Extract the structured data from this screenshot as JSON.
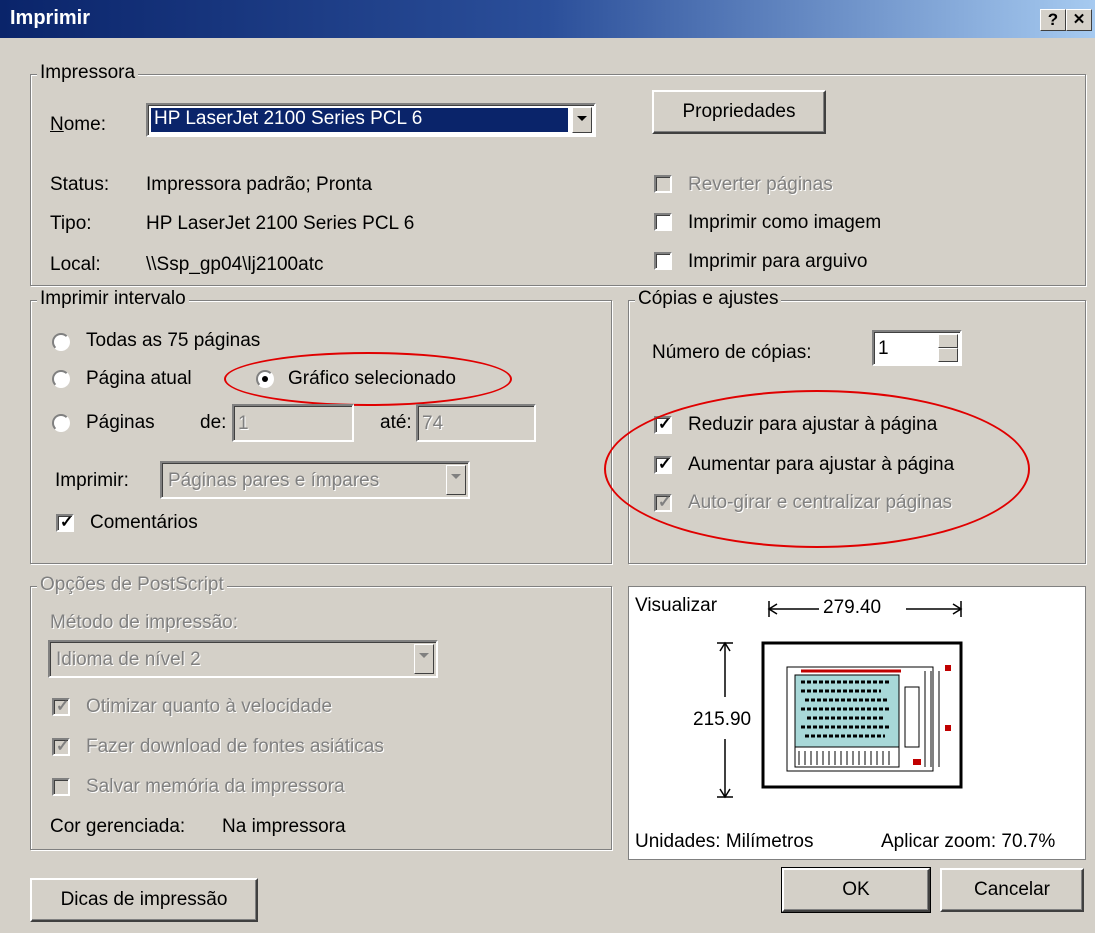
{
  "window": {
    "title": "Imprimir",
    "help_label": "?",
    "close_label": "✕"
  },
  "printer": {
    "legend": "Impressora",
    "name_label": "Nome:",
    "name_value": "HP LaserJet 2100 Series PCL 6",
    "properties_label": "Propriedades",
    "status_label": "Status:",
    "status_value": "Impressora padrão; Pronta",
    "type_label": "Tipo:",
    "type_value": "HP LaserJet 2100 Series PCL 6",
    "location_label": "Local:",
    "location_value": "\\\\Ssp_gp04\\lj2100atc",
    "reverse_pages_label": "Reverter páginas",
    "print_as_image_label": "Imprimir como imagem",
    "print_to_file_label": "Imprimir para arguivo"
  },
  "range": {
    "legend": "Imprimir intervalo",
    "all_pages_label": "Todas as 75 páginas",
    "current_page_label": "Página atual",
    "selected_graphic_label": "Gráfico selecionado",
    "pages_label": "Páginas",
    "from_label": "de:",
    "from_value": "1",
    "to_label": "até:",
    "to_value": "74",
    "print_label": "Imprimir:",
    "print_value": "Páginas pares e ímpares",
    "comments_label": "Comentários",
    "selected": "selected_graphic"
  },
  "copies": {
    "legend": "Cópias e ajustes",
    "copies_label": "Número de cópias:",
    "copies_value": "1",
    "shrink_label": "Reduzir para ajustar à página",
    "expand_label": "Aumentar para ajustar à página",
    "autorotate_label": "Auto-girar e centralizar páginas"
  },
  "postscript": {
    "legend": "Opções de PostScript",
    "method_label": "Método de impressão:",
    "method_value": "Idioma de nível 2",
    "optimize_label": "Otimizar quanto à velocidade",
    "download_fonts_label": "Fazer download de fontes asiáticas",
    "save_memory_label": "Salvar memória da impressora",
    "color_label": "Cor gerenciada:",
    "color_value": "Na impressora"
  },
  "preview": {
    "label": "Visualizar",
    "width_value": "279.40",
    "height_value": "215.90",
    "units_label": "Unidades: Milímetros",
    "zoom_label": "Aplicar zoom: 70.7%"
  },
  "footer": {
    "tips_label": "Dicas de impressão",
    "ok_label": "OK",
    "cancel_label": "Cancelar"
  },
  "colors": {
    "titlebar": "#0a246a",
    "annotation": "#e00000",
    "selection": "#0a246a"
  }
}
